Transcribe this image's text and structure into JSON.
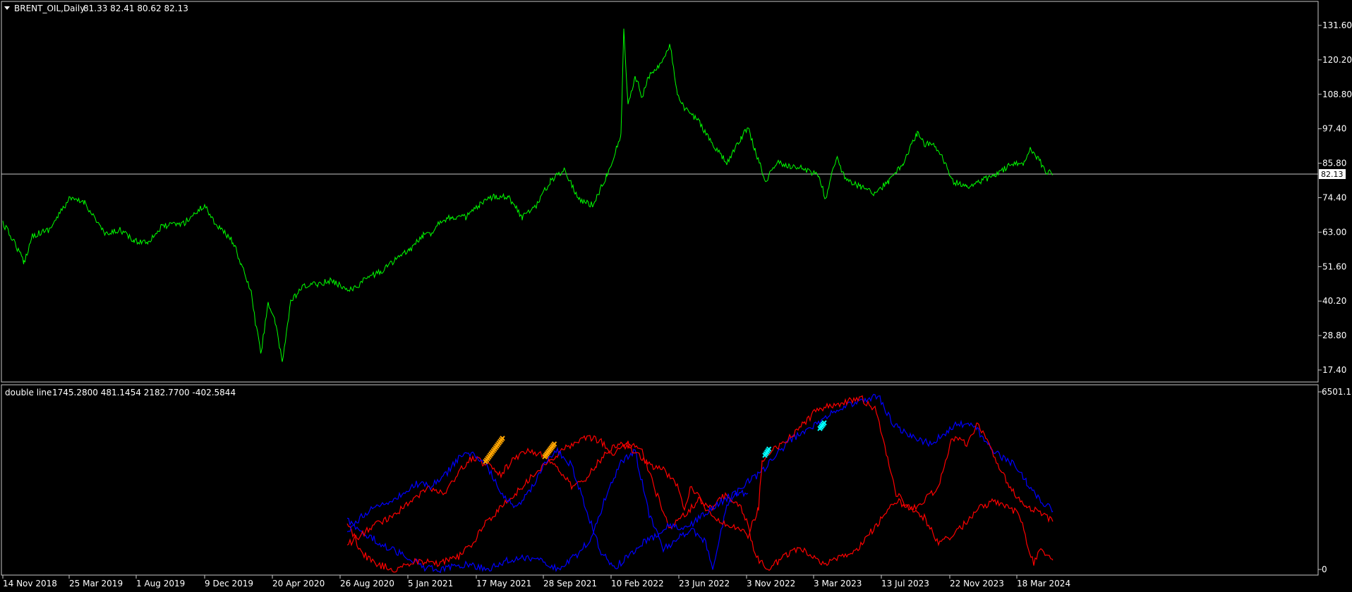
{
  "main_panel": {
    "symbol": "BRENT_OIL,Daily",
    "ohlc": "81.33 82.41 80.62 82.13",
    "current_price": "82.13",
    "price_axis": [
      "131.60",
      "120.20",
      "108.80",
      "97.40",
      "85.80",
      "74.40",
      "63.00",
      "51.60",
      "40.20",
      "28.80",
      "17.40"
    ],
    "line_color": "#00ff00"
  },
  "indicator_panel": {
    "name": "double line",
    "values": "1745.2800 481.1454 2182.7700 -402.5844",
    "axis_top": "6501.15",
    "axis_bottom": "0",
    "colors": {
      "red": "#ff0000",
      "blue": "#0000ff",
      "orange": "#ffa500",
      "cyan": "#00ffff"
    }
  },
  "time_axis": [
    "14 Nov 2018",
    "25 Mar 2019",
    "1 Aug 2019",
    "9 Dec 2019",
    "20 Apr 2020",
    "26 Aug 2020",
    "5 Jan 2021",
    "17 May 2021",
    "28 Sep 2021",
    "10 Feb 2022",
    "23 Jun 2022",
    "3 Nov 2022",
    "3 Mar 2023",
    "13 Jul 2023",
    "22 Nov 2023",
    "18 Mar 2024"
  ],
  "chart_data": {
    "type": "line",
    "price_series": {
      "x": [
        "14 Nov 2018",
        "25 Mar 2019",
        "1 Aug 2019",
        "9 Dec 2019",
        "20 Apr 2020",
        "26 Aug 2020",
        "5 Jan 2021",
        "17 May 2021",
        "28 Sep 2021",
        "10 Feb 2022",
        "23 Jun 2022",
        "3 Nov 2022",
        "3 Mar 2023",
        "13 Jul 2023",
        "22 Nov 2023",
        "18 Mar 2024"
      ],
      "y": [
        66,
        68,
        62,
        66,
        20,
        45,
        55,
        70,
        77,
        105,
        112,
        92,
        78,
        82,
        80,
        85
      ],
      "ylim": [
        17.4,
        131.6
      ]
    },
    "indicator_ylim": [
      0,
      6501.15
    ]
  }
}
